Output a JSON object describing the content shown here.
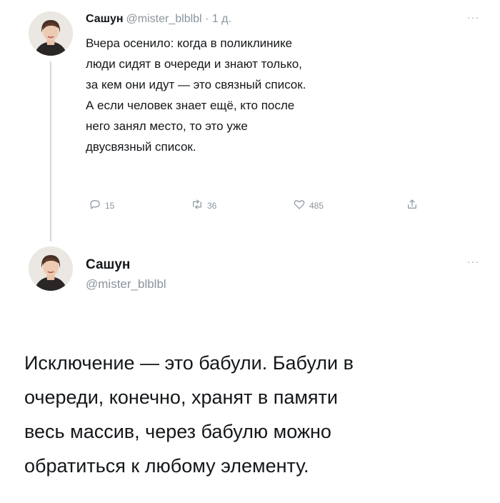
{
  "tweet1": {
    "author_name": "Сашун",
    "meta": "@mister_blblbl · 1 д.",
    "more": "···",
    "text_lines": [
      "Вчера осенило: когда в поликлинике",
      "люди сидят в очереди и знают только,",
      "за кем они идут — это связный список.",
      "А если человек знает ещё, кто после",
      "него занял место, то это уже",
      "двусвязный список."
    ],
    "actions": {
      "reply_count": "15",
      "retweet_count": "36",
      "like_count": "485",
      "reply_icon": "reply-icon",
      "retweet_icon": "retweet-icon",
      "like_icon": "heart-icon",
      "share_icon": "share-icon"
    }
  },
  "tweet2": {
    "author_name": "Сашун",
    "handle": "@mister_blblbl",
    "more": "···",
    "text_lines": [
      "Исключение — это бабули. Бабули в",
      "очереди, конечно, хранят в памяти",
      "весь массив, через бабулю можно",
      "обратиться к любому элементу."
    ]
  },
  "colors": {
    "text": "#14171a",
    "secondary_text": "#8a949c",
    "thread_line": "#cfd9de"
  }
}
